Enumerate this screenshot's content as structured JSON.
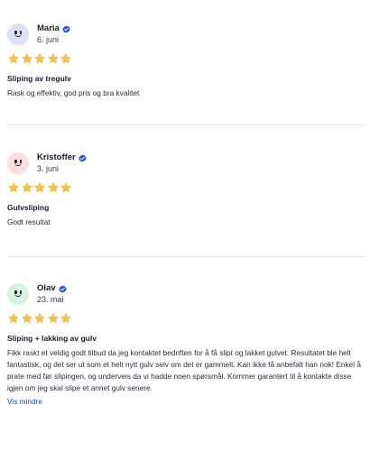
{
  "reviews": [
    {
      "name": "Maria",
      "date": "6. juni",
      "avatar_color": "#dde1f7",
      "rating": 5,
      "title": "Sliping av tregulv",
      "body": "Rask og effektiv, god pris og bra kvalitet"
    },
    {
      "name": "Kristoffer",
      "date": "3. juni",
      "avatar_color": "#fbdede",
      "rating": 5,
      "title": "Gulvsliping",
      "body": "Godt resultat"
    },
    {
      "name": "Olav",
      "date": "23. mai",
      "avatar_color": "#d6f2e1",
      "rating": 5,
      "title": "Sliping + lakking av gulv",
      "body": "Fikk raskt et veldig godt tilbud da jeg kontaktet bedriften for å få slipt og lakket gulvet. Resultatet ble helt fantastisk, og det ser ut som et helt nytt gulv selv om det er gammelt. Kan ikke få anbefalt han nok! Enkel å prate med før slipingen, og underveis da vi hadde noen spørsmål. Kommer garantert til å kontakte disse igjen om jeg skal slipe et annet gulv senere.",
      "more_label": "Vis mindre"
    }
  ],
  "icons": {
    "verified": "verified-badge-icon",
    "star": "star-icon"
  },
  "colors": {
    "star": "#f5c04a",
    "verified": "#2c55d8",
    "link": "#1b45c9"
  }
}
